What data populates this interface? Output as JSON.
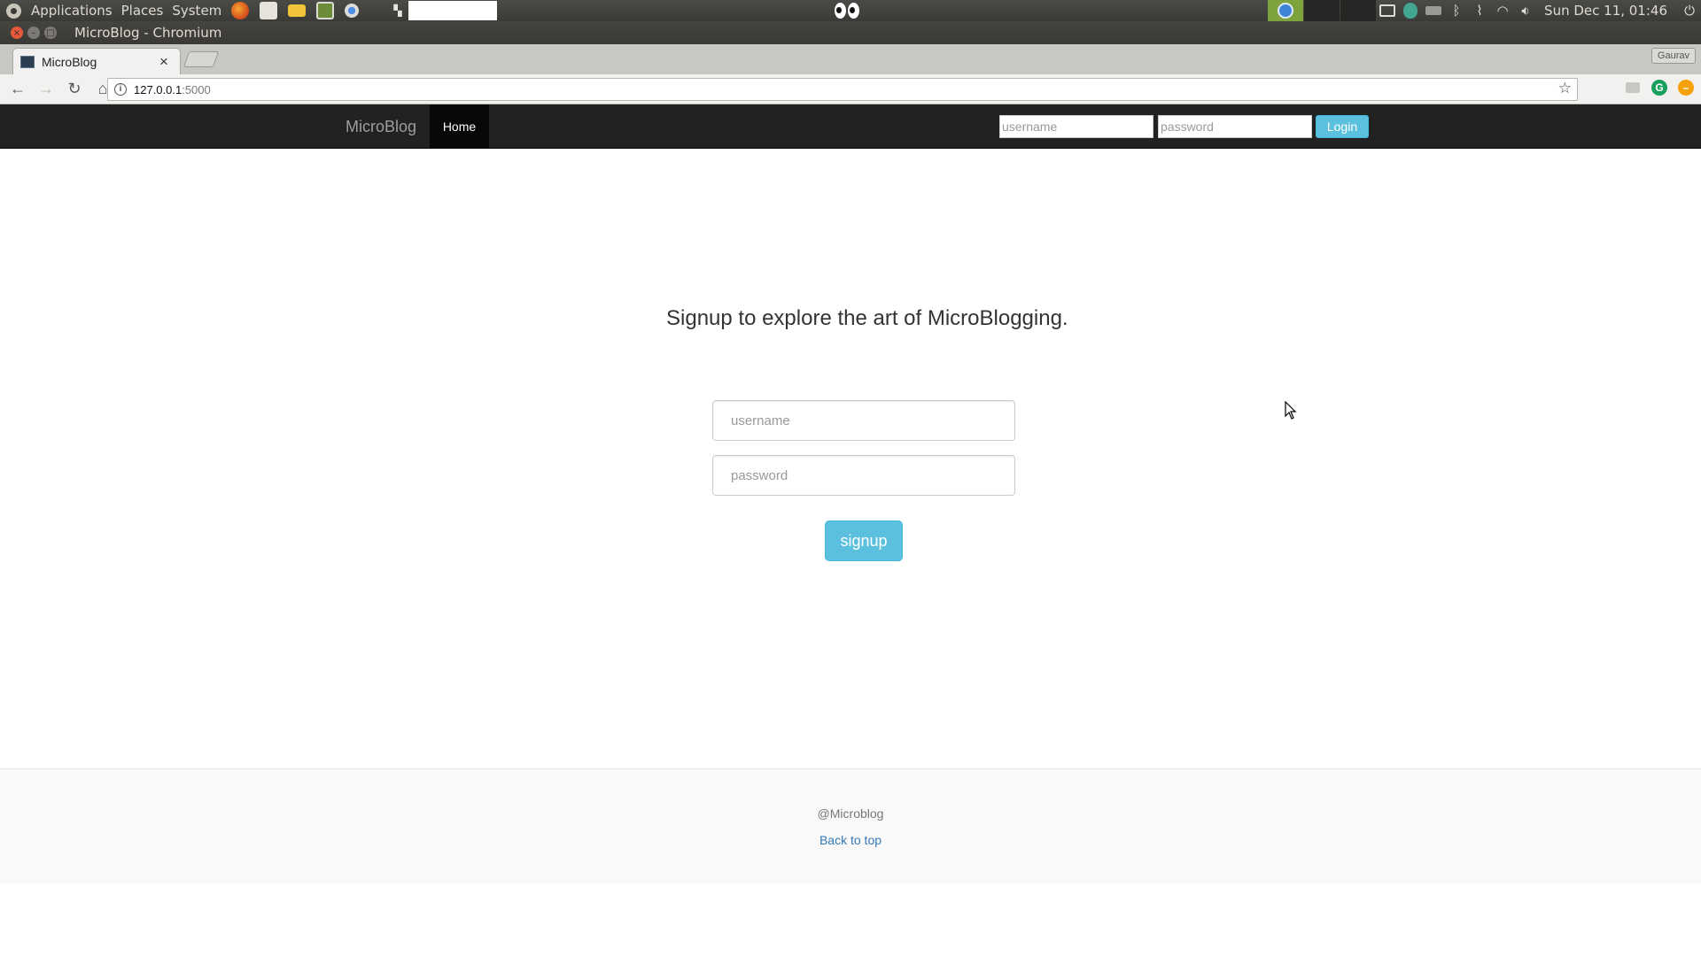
{
  "os_panel": {
    "menus": [
      "Applications",
      "Places",
      "System"
    ],
    "clock": "Sun Dec 11, 01:46"
  },
  "window": {
    "title": "MicroBlog - Chromium",
    "close_glyph": "×",
    "min_glyph": "–",
    "max_glyph": "□"
  },
  "browser": {
    "tab_title": "MicroBlog",
    "tab_close": "×",
    "profile": "Gaurav",
    "url_host": "127.0.0.1",
    "url_port": ":5000",
    "icons": {
      "back": "←",
      "forward": "→",
      "reload": "↻",
      "home": "⌂",
      "info": "i",
      "star": "☆",
      "ext_green": "G",
      "ext_orange": "–"
    }
  },
  "navbar": {
    "brand": "MicroBlog",
    "home": "Home",
    "username_placeholder": "username",
    "password_placeholder": "password",
    "login": "Login"
  },
  "main": {
    "headline": "Signup to explore the art of MicroBlogging.",
    "username_placeholder": "username",
    "password_placeholder": "password",
    "signup": "signup"
  },
  "footer": {
    "copyright": "@Microblog",
    "back_to_top": "Back to top"
  },
  "colors": {
    "navbar_bg": "#222222",
    "accent_info": "#5bc0de",
    "link": "#337ab7"
  }
}
